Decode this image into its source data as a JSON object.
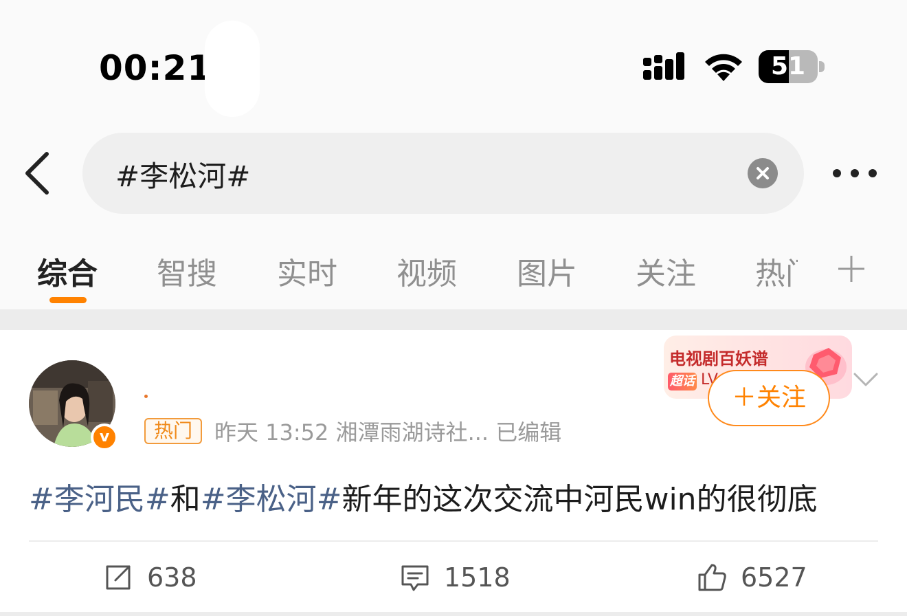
{
  "status_bar": {
    "time": "00:21",
    "battery_level": "51",
    "battery_fraction": 0.51
  },
  "search": {
    "query": "#李松河#"
  },
  "tabs": [
    {
      "label": "综合",
      "active": true
    },
    {
      "label": "智搜",
      "active": false
    },
    {
      "label": "实时",
      "active": false
    },
    {
      "label": "视频",
      "active": false
    },
    {
      "label": "图片",
      "active": false
    },
    {
      "label": "关注",
      "active": false
    },
    {
      "label": "热门",
      "active": false
    }
  ],
  "post": {
    "hot_tag": "热门",
    "meta": "昨天 13:52  湘潭雨湖诗社...  已编辑",
    "super_topic": {
      "title": "电视剧百妖谱",
      "tag": "超话",
      "level": "LV"
    },
    "follow_label": "＋关注",
    "text": {
      "topic1": "#李河民#",
      "connector": "和",
      "topic2": "#李松河#",
      "body": "新年的这次交流中河民win的很彻底"
    },
    "actions": {
      "reposts": "638",
      "comments": "1518",
      "likes": "6527"
    }
  },
  "colors": {
    "accent": "#ff8200",
    "topic_link": "#4a6187",
    "muted_text": "#9a9a9a"
  }
}
